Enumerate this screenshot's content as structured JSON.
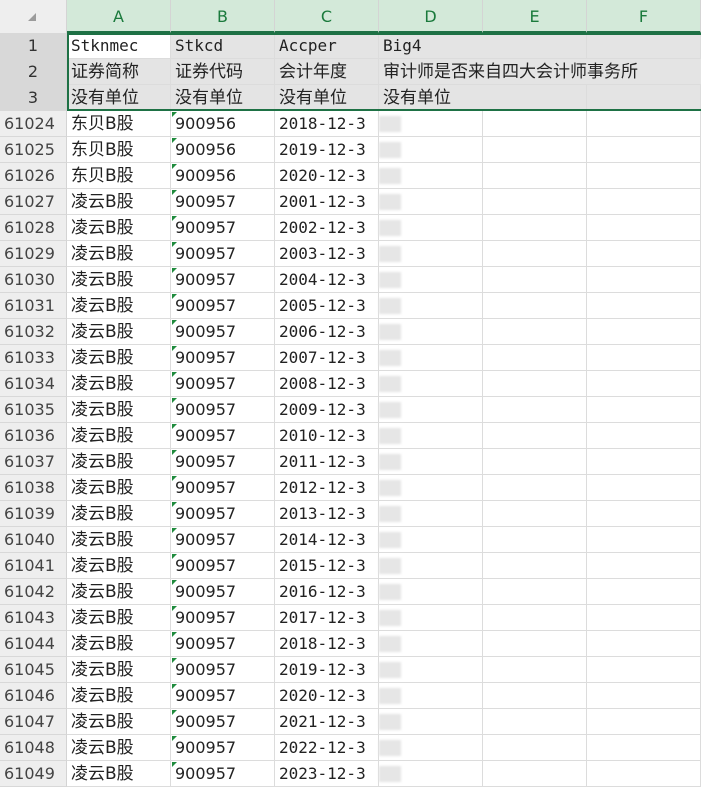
{
  "columns": [
    "A",
    "B",
    "C",
    "D",
    "E",
    "F"
  ],
  "corner_icon": "select-all-triangle",
  "header_rows": [
    {
      "row": "1",
      "a": "Stknmec",
      "b": "Stkcd",
      "c": "Accper",
      "d": "Big4"
    },
    {
      "row": "2",
      "a": "证券简称",
      "b": "证券代码",
      "c": "会计年度",
      "d": "审计师是否来自四大会计师事务所"
    },
    {
      "row": "3",
      "a": "没有单位",
      "b": "没有单位",
      "c": "没有单位",
      "d": "没有单位"
    }
  ],
  "data_rows": [
    {
      "row": "61024",
      "a": "东贝B股",
      "b": "900956",
      "c": "2018-12-3"
    },
    {
      "row": "61025",
      "a": "东贝B股",
      "b": "900956",
      "c": "2019-12-3"
    },
    {
      "row": "61026",
      "a": "东贝B股",
      "b": "900956",
      "c": "2020-12-3"
    },
    {
      "row": "61027",
      "a": "凌云B股",
      "b": "900957",
      "c": "2001-12-3"
    },
    {
      "row": "61028",
      "a": "凌云B股",
      "b": "900957",
      "c": "2002-12-3"
    },
    {
      "row": "61029",
      "a": "凌云B股",
      "b": "900957",
      "c": "2003-12-3"
    },
    {
      "row": "61030",
      "a": "凌云B股",
      "b": "900957",
      "c": "2004-12-3"
    },
    {
      "row": "61031",
      "a": "凌云B股",
      "b": "900957",
      "c": "2005-12-3"
    },
    {
      "row": "61032",
      "a": "凌云B股",
      "b": "900957",
      "c": "2006-12-3"
    },
    {
      "row": "61033",
      "a": "凌云B股",
      "b": "900957",
      "c": "2007-12-3"
    },
    {
      "row": "61034",
      "a": "凌云B股",
      "b": "900957",
      "c": "2008-12-3"
    },
    {
      "row": "61035",
      "a": "凌云B股",
      "b": "900957",
      "c": "2009-12-3"
    },
    {
      "row": "61036",
      "a": "凌云B股",
      "b": "900957",
      "c": "2010-12-3"
    },
    {
      "row": "61037",
      "a": "凌云B股",
      "b": "900957",
      "c": "2011-12-3"
    },
    {
      "row": "61038",
      "a": "凌云B股",
      "b": "900957",
      "c": "2012-12-3"
    },
    {
      "row": "61039",
      "a": "凌云B股",
      "b": "900957",
      "c": "2013-12-3"
    },
    {
      "row": "61040",
      "a": "凌云B股",
      "b": "900957",
      "c": "2014-12-3"
    },
    {
      "row": "61041",
      "a": "凌云B股",
      "b": "900957",
      "c": "2015-12-3"
    },
    {
      "row": "61042",
      "a": "凌云B股",
      "b": "900957",
      "c": "2016-12-3"
    },
    {
      "row": "61043",
      "a": "凌云B股",
      "b": "900957",
      "c": "2017-12-3"
    },
    {
      "row": "61044",
      "a": "凌云B股",
      "b": "900957",
      "c": "2018-12-3"
    },
    {
      "row": "61045",
      "a": "凌云B股",
      "b": "900957",
      "c": "2019-12-3"
    },
    {
      "row": "61046",
      "a": "凌云B股",
      "b": "900957",
      "c": "2020-12-3"
    },
    {
      "row": "61047",
      "a": "凌云B股",
      "b": "900957",
      "c": "2021-12-3"
    },
    {
      "row": "61048",
      "a": "凌云B股",
      "b": "900957",
      "c": "2022-12-3"
    },
    {
      "row": "61049",
      "a": "凌云B股",
      "b": "900957",
      "c": "2023-12-3"
    }
  ],
  "colors": {
    "selection": "#1e7145",
    "header_bg": "#eeeeee",
    "number_as_text_marker": "#1f8b3d"
  }
}
